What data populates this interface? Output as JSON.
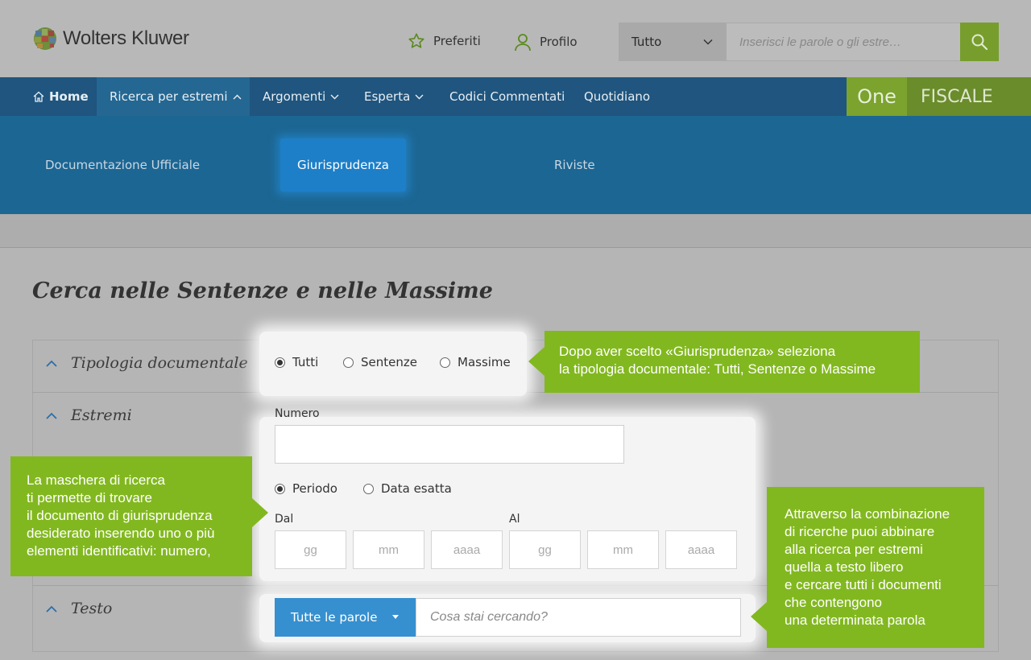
{
  "header": {
    "logo_text": "Wolters Kluwer",
    "preferiti": "Preferiti",
    "profilo": "Profilo",
    "scope": "Tutto",
    "search_placeholder": "Inserisci le parole o gli estre…"
  },
  "nav": {
    "home": "Home",
    "ricerca": "Ricerca per estremi",
    "argomenti": "Argomenti",
    "esperta": "Esperta",
    "codici": "Codici Commentati",
    "quotidiano": "Quotidiano",
    "one": "One",
    "fiscale": "FISCALE"
  },
  "dropdown": {
    "documentazione": "Documentazione Ufficiale",
    "giurisprudenza": "Giurisprudenza",
    "riviste": "Riviste"
  },
  "page": {
    "title": "Cerca nelle Sentenze e nelle Massime"
  },
  "sections": {
    "tipologia": "Tipologia documentale",
    "estremi": "Estremi",
    "testo": "Testo"
  },
  "tipologia_options": {
    "tutti": "Tutti",
    "sentenze": "Sentenze",
    "massime": "Massime",
    "selected": "Tutti"
  },
  "estremi": {
    "numero_label": "Numero",
    "numero_value": "",
    "periodo": "Periodo",
    "data_esatta": "Data esatta",
    "selected": "Periodo",
    "dal": "Dal",
    "al": "Al",
    "gg": "gg",
    "mm": "mm",
    "aaaa": "aaaa"
  },
  "testo": {
    "mode": "Tutte le parole",
    "placeholder": "Cosa stai cercando?"
  },
  "callouts": {
    "tipologia": "Dopo aver scelto «Giurisprudenza» seleziona\nla tipologia documentale: Tutti, Sentenze o Massime",
    "maschera": "La maschera di ricerca\nti permette di trovare\nil documento di giurisprudenza\ndesiderato inserendo uno o più\nelementi identificativi: numero,",
    "combinazione": "Attraverso la combinazione\ndi ricerche puoi abbinare\nalla ricerca per estremi\nquella a testo libero\ne cercare tutti i documenti\nche contengono\nuna determinata parola"
  },
  "colors": {
    "nav": "#1f557e",
    "dropdown": "#1c6693",
    "accent_green": "#82b81f",
    "button_blue": "#3690cf"
  }
}
